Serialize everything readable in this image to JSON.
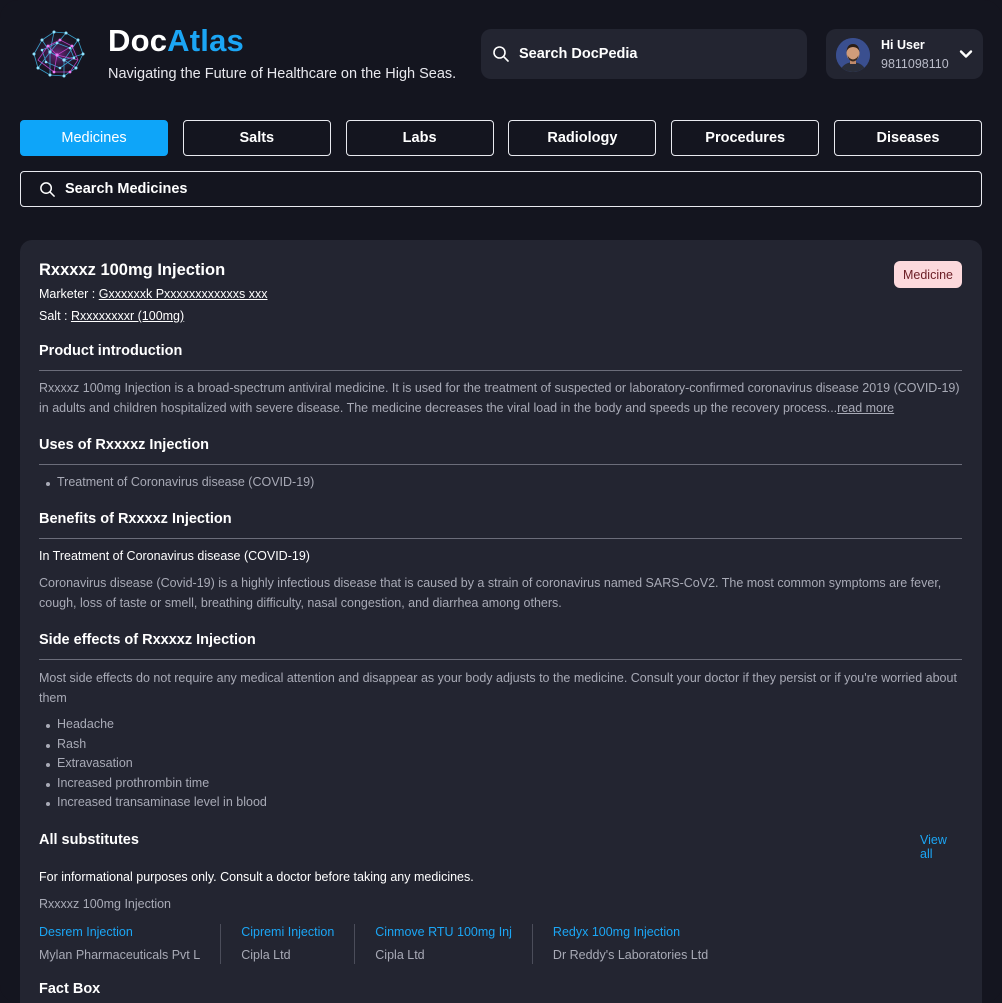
{
  "brand": {
    "name_part1": "Doc",
    "name_part2": "Atlas",
    "tagline": "Navigating the Future of Healthcare on the High Seas."
  },
  "top_search": {
    "placeholder": "Search DocPedia",
    "icon": "search-icon"
  },
  "user": {
    "greeting": "Hi User",
    "phone": "9811098110",
    "chevron_icon": "chevron-down-icon"
  },
  "tabs": [
    {
      "label": "Medicines",
      "active": true
    },
    {
      "label": "Salts",
      "active": false
    },
    {
      "label": "Labs",
      "active": false
    },
    {
      "label": "Radiology",
      "active": false
    },
    {
      "label": "Procedures",
      "active": false
    },
    {
      "label": "Diseases",
      "active": false
    }
  ],
  "medicine_search": {
    "placeholder": "Search Medicines",
    "icon": "search-icon"
  },
  "product": {
    "title": "Rxxxxz 100mg Injection",
    "badge": "Medicine",
    "marketer_label": "Marketer : ",
    "marketer_value": "Gxxxxxxk Pxxxxxxxxxxxxs xxx",
    "salt_label": "Salt : ",
    "salt_value": "Rxxxxxxxxr (100mg)"
  },
  "sections": {
    "introduction": {
      "title": "Product introduction",
      "text": "Rxxxxz 100mg Injection is a broad-spectrum antiviral medicine. It is used for the treatment of suspected or laboratory-confirmed coronavirus disease 2019 (COVID-19) in adults and children hospitalized with severe disease. The medicine decreases the viral load in the body and speeds up the recovery process...",
      "read_more": "read more"
    },
    "uses": {
      "title": "Uses of Rxxxxz Injection",
      "items": [
        "Treatment of Coronavirus disease (COVID-19)"
      ]
    },
    "benefits": {
      "title": "Benefits of Rxxxxz Injection",
      "subtitle": "In Treatment of Coronavirus disease (COVID-19)",
      "text": "Coronavirus disease (Covid-19) is a highly infectious disease that is caused by a strain of coronavirus named SARS-CoV2. The most common symptoms are fever, cough, loss of taste or smell, breathing difficulty, nasal congestion, and diarrhea among others."
    },
    "side_effects": {
      "title": "Side effects of Rxxxxz Injection",
      "text": "Most side effects do not require any medical attention and disappear as your body adjusts to the medicine. Consult your doctor if they persist or if you're worried about them",
      "items": [
        "Headache",
        "Rash",
        "Extravasation",
        "Increased prothrombin time",
        "Increased transaminase level in blood"
      ]
    },
    "substitutes": {
      "title": "All substitutes",
      "view_all": "View all",
      "disclaimer": "For informational purposes only. Consult a doctor before taking any medicines.",
      "current": "Rxxxxz 100mg Injection",
      "items": [
        {
          "name": "Desrem Injection",
          "maker": "Mylan Pharmaceuticals Pvt L"
        },
        {
          "name": "Cipremi Injection",
          "maker": "Cipla Ltd"
        },
        {
          "name": "Cinmove RTU 100mg Inj",
          "maker": "Cipla Ltd"
        },
        {
          "name": "Redyx 100mg Injection",
          "maker": "Dr Reddy's Laboratories Ltd"
        }
      ]
    },
    "fact_box": {
      "title": "Fact Box"
    }
  },
  "colors": {
    "accent": "#1ba6f5",
    "active_tab": "#0ea5f9",
    "background": "#14151f",
    "card": "#232531",
    "badge_bg": "#fcd9dc",
    "badge_text": "#6a1d24"
  }
}
